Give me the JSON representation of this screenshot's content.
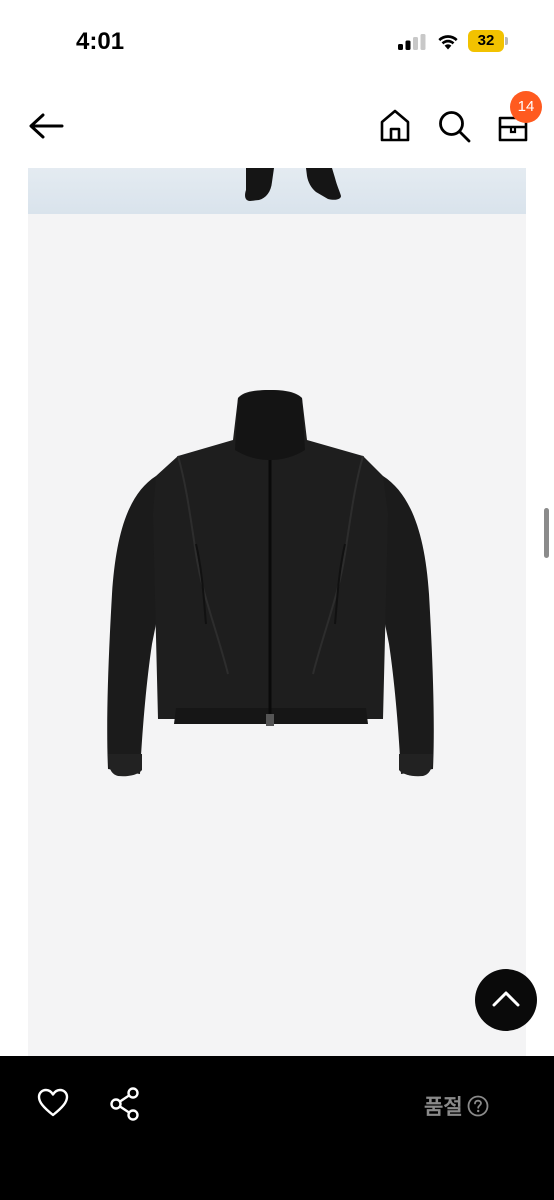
{
  "status_bar": {
    "time": "4:01",
    "battery": "32"
  },
  "header": {
    "cart_count": "14"
  },
  "icons": {
    "back": "back-arrow-icon",
    "home": "home-icon",
    "search": "search-icon",
    "bag": "shopping-bag-icon",
    "like": "heart-icon",
    "share": "share-icon",
    "scroll_top": "chevron-up-icon",
    "help": "question-circle-icon"
  },
  "bottom_bar": {
    "status_label": "품절"
  },
  "colors": {
    "badge": "#ff5a1f",
    "bottom_bar": "#000000",
    "battery": "#f2c200"
  }
}
